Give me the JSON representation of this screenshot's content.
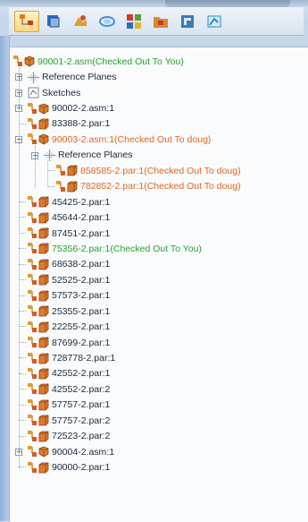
{
  "toolbar": {
    "buttons": [
      {
        "name": "assembly-tree-icon",
        "color": "#e07a1f"
      },
      {
        "name": "layers-icon",
        "color": "#2f6db5"
      },
      {
        "name": "parts-library-icon",
        "color": "#d9a02b"
      },
      {
        "name": "features-icon",
        "color": "#4d8fd1"
      },
      {
        "name": "colors-icon",
        "color": "#5c9a3a"
      },
      {
        "name": "folder-icon",
        "color": "#d88a2a"
      },
      {
        "name": "sensors-icon",
        "color": "#3a7abf"
      },
      {
        "name": "sketch-view-icon",
        "color": "#2e88c9"
      }
    ]
  },
  "tree": {
    "items": [
      {
        "label": "90001-2.asm(Checked Out To You)",
        "color": "green",
        "icon": "assembly",
        "indent": 0,
        "expander": "none"
      },
      {
        "label": "Reference Planes",
        "color": "black",
        "icon": "planes",
        "indent": 1,
        "expander": "plus"
      },
      {
        "label": "Sketches",
        "color": "black",
        "icon": "sketches",
        "indent": 1,
        "expander": "plus"
      },
      {
        "label": "90002-2.asm:1",
        "color": "black",
        "icon": "assembly",
        "indent": 1,
        "expander": "plus"
      },
      {
        "label": "83388-2.par:1",
        "color": "black",
        "icon": "part",
        "indent": 1,
        "expander": "none"
      },
      {
        "label": "90003-2.asm:1(Checked Out To doug)",
        "color": "orange",
        "icon": "assembly",
        "indent": 1,
        "expander": "minus"
      },
      {
        "label": "Reference Planes",
        "color": "black",
        "icon": "planes",
        "indent": 2,
        "expander": "plus"
      },
      {
        "label": "858585-2.par:1(Checked Out To doug)",
        "color": "orange",
        "icon": "part",
        "indent": 3,
        "expander": "none"
      },
      {
        "label": "782852-2.par:1(Checked Out To doug)",
        "color": "orange",
        "icon": "part",
        "indent": 3,
        "expander": "none"
      },
      {
        "label": "45425-2.par:1",
        "color": "black",
        "icon": "part",
        "indent": 1,
        "expander": "none"
      },
      {
        "label": "45644-2.par:1",
        "color": "black",
        "icon": "part",
        "indent": 1,
        "expander": "none"
      },
      {
        "label": "87451-2.par:1",
        "color": "black",
        "icon": "part",
        "indent": 1,
        "expander": "none"
      },
      {
        "label": "75356-2.par:1(Checked Out To You)",
        "color": "green",
        "icon": "part",
        "indent": 1,
        "expander": "none"
      },
      {
        "label": "68638-2.par:1",
        "color": "black",
        "icon": "part",
        "indent": 1,
        "expander": "none"
      },
      {
        "label": "52525-2.par:1",
        "color": "black",
        "icon": "part",
        "indent": 1,
        "expander": "none"
      },
      {
        "label": "57573-2.par:1",
        "color": "black",
        "icon": "part",
        "indent": 1,
        "expander": "none"
      },
      {
        "label": "25355-2.par:1",
        "color": "black",
        "icon": "part",
        "indent": 1,
        "expander": "none"
      },
      {
        "label": "22255-2.par:1",
        "color": "black",
        "icon": "part",
        "indent": 1,
        "expander": "none"
      },
      {
        "label": "87699-2.par:1",
        "color": "black",
        "icon": "part",
        "indent": 1,
        "expander": "none"
      },
      {
        "label": "728778-2.par:1",
        "color": "black",
        "icon": "part",
        "indent": 1,
        "expander": "none"
      },
      {
        "label": "42552-2.par:1",
        "color": "black",
        "icon": "part",
        "indent": 1,
        "expander": "none"
      },
      {
        "label": "42552-2.par:2",
        "color": "black",
        "icon": "part",
        "indent": 1,
        "expander": "none"
      },
      {
        "label": "57757-2.par:1",
        "color": "black",
        "icon": "part",
        "indent": 1,
        "expander": "none"
      },
      {
        "label": "57757-2.par:2",
        "color": "black",
        "icon": "part",
        "indent": 1,
        "expander": "none"
      },
      {
        "label": "72523-2.par:2",
        "color": "black",
        "icon": "part",
        "indent": 1,
        "expander": "none"
      },
      {
        "label": "90004-2.asm:1",
        "color": "black",
        "icon": "assembly",
        "indent": 1,
        "expander": "plus"
      },
      {
        "label": "90000-2.par:1",
        "color": "black",
        "icon": "part",
        "indent": 1,
        "expander": "none"
      }
    ]
  },
  "colors": {
    "green": "#27a12c",
    "orange": "#e2651e",
    "black": "#1b2838"
  }
}
